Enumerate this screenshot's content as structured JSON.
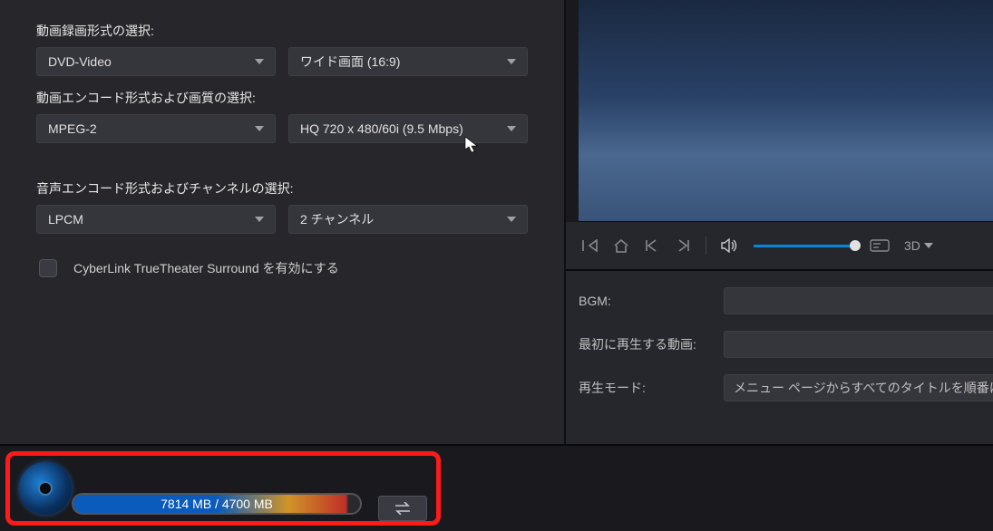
{
  "left": {
    "recFormatLabel": "動画録画形式の選択:",
    "recFormat": "DVD-Video",
    "aspect": "ワイド画面 (16:9)",
    "encodeLabel": "動画エンコード形式および画質の選択:",
    "videoCodec": "MPEG-2",
    "videoQuality": "HQ 720 x 480/60i (9.5 Mbps)",
    "audioLabel": "音声エンコード形式およびチャンネルの選択:",
    "audioCodec": "LPCM",
    "channels": "2 チャンネル",
    "truetheater": "CyberLink TrueTheater Surround を有効にする"
  },
  "controls": {
    "threeD": "3D"
  },
  "meta": {
    "bgmLabel": "BGM:",
    "firstPlayLabel": "最初に再生する動画:",
    "playModeLabel": "再生モード:",
    "playModeValue": "メニュー ページからすべてのタイトルを順番に再生す"
  },
  "capacity": {
    "text": "7814 MB / 4700 MB"
  }
}
